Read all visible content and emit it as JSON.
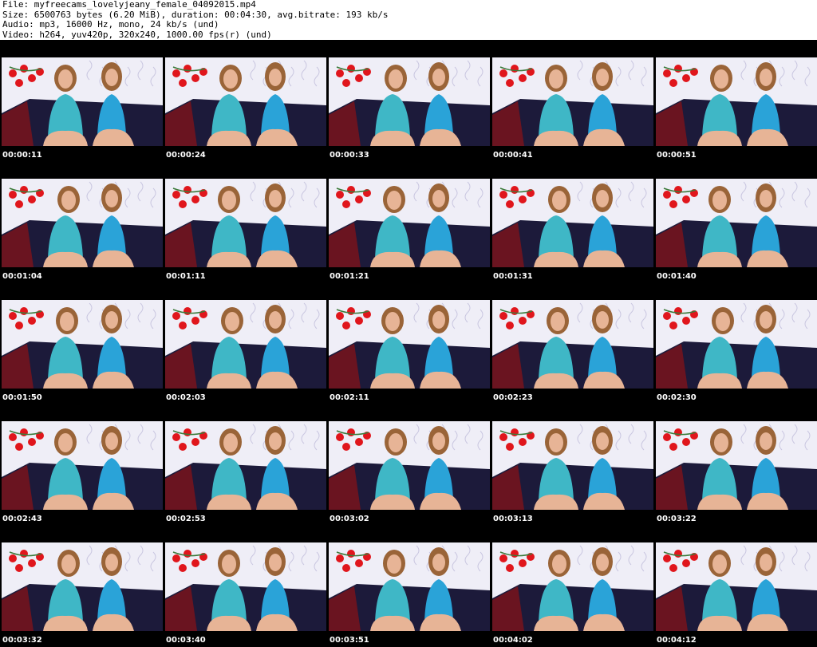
{
  "header": {
    "file_line": "File: myfreecams_lovelyjeany_female_04092015.mp4",
    "size_line": "Size: 6500763 bytes (6.20 MiB), duration: 00:04:30, avg.bitrate: 193 kb/s",
    "audio_line": "Audio: mp3, 16000 Hz, mono, 24 kb/s (und)",
    "video_line": "Video: h264, yuv420p, 320x240, 1000.00 fps(r) (und)"
  },
  "colors": {
    "wall": "#efeef7",
    "roses": "#e0161c",
    "couch": "#1c1a3a",
    "couch_side": "#6a1420",
    "top_left": "#3fb7c6",
    "top_right": "#2aa3d8",
    "skin": "#e7b496",
    "hair": "#9a6438"
  },
  "frames": [
    {
      "time": "00:00:11"
    },
    {
      "time": "00:00:24"
    },
    {
      "time": "00:00:33"
    },
    {
      "time": "00:00:41"
    },
    {
      "time": "00:00:51"
    },
    {
      "time": "00:01:04"
    },
    {
      "time": "00:01:11"
    },
    {
      "time": "00:01:21"
    },
    {
      "time": "00:01:31"
    },
    {
      "time": "00:01:40"
    },
    {
      "time": "00:01:50"
    },
    {
      "time": "00:02:03"
    },
    {
      "time": "00:02:11"
    },
    {
      "time": "00:02:23"
    },
    {
      "time": "00:02:30"
    },
    {
      "time": "00:02:43"
    },
    {
      "time": "00:02:53"
    },
    {
      "time": "00:03:02"
    },
    {
      "time": "00:03:13"
    },
    {
      "time": "00:03:22"
    },
    {
      "time": "00:03:32"
    },
    {
      "time": "00:03:40"
    },
    {
      "time": "00:03:51"
    },
    {
      "time": "00:04:02"
    },
    {
      "time": "00:04:12"
    }
  ]
}
